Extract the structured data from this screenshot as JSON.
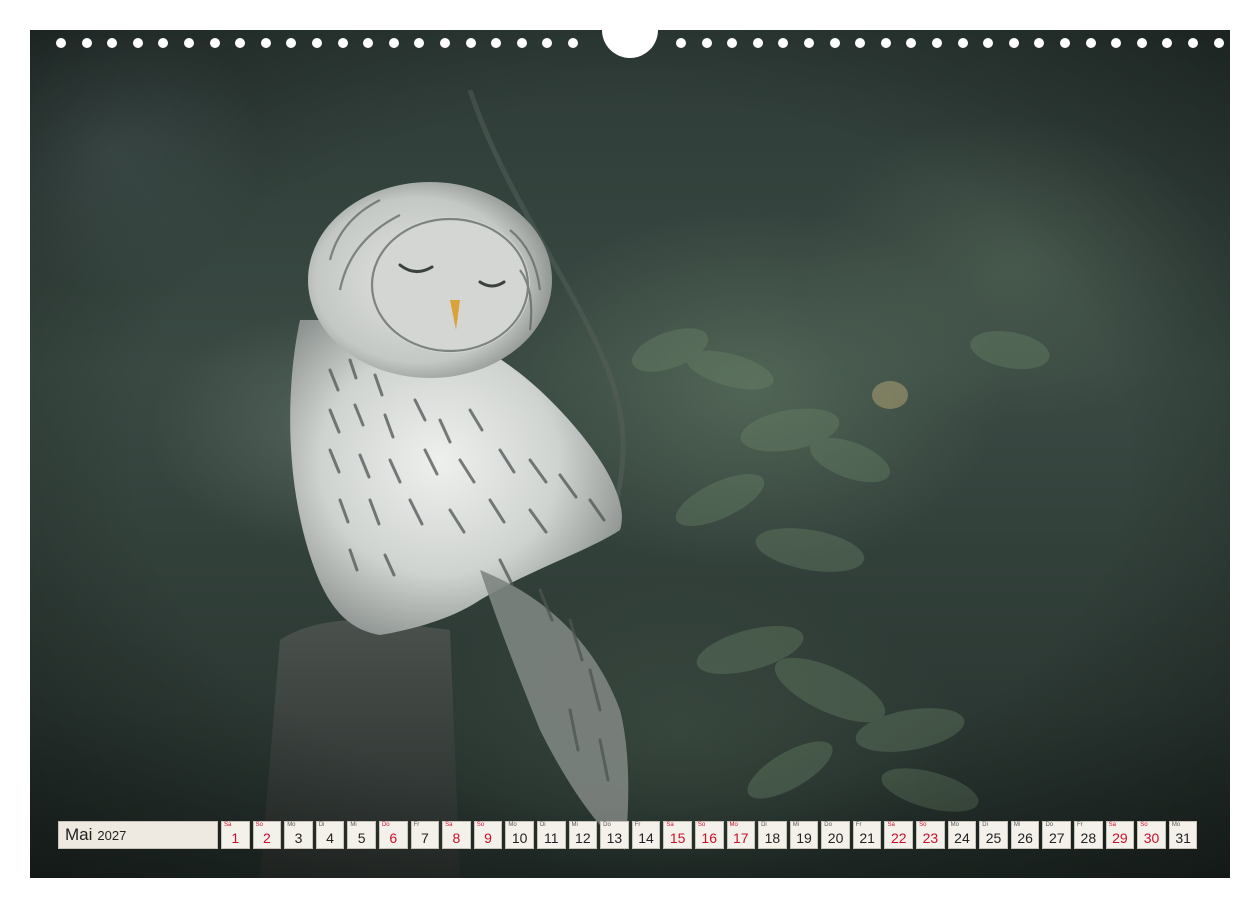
{
  "calendar": {
    "month": "Mai",
    "year": "2027",
    "weekend_color": "#c8102e",
    "days": [
      {
        "wd": "Sa",
        "d": "1",
        "red": true
      },
      {
        "wd": "So",
        "d": "2",
        "red": true
      },
      {
        "wd": "Mo",
        "d": "3",
        "red": false
      },
      {
        "wd": "Di",
        "d": "4",
        "red": false
      },
      {
        "wd": "Mi",
        "d": "5",
        "red": false
      },
      {
        "wd": "Do",
        "d": "6",
        "red": true
      },
      {
        "wd": "Fr",
        "d": "7",
        "red": false
      },
      {
        "wd": "Sa",
        "d": "8",
        "red": true
      },
      {
        "wd": "So",
        "d": "9",
        "red": true
      },
      {
        "wd": "Mo",
        "d": "10",
        "red": false
      },
      {
        "wd": "Di",
        "d": "11",
        "red": false
      },
      {
        "wd": "Mi",
        "d": "12",
        "red": false
      },
      {
        "wd": "Do",
        "d": "13",
        "red": false
      },
      {
        "wd": "Fr",
        "d": "14",
        "red": false
      },
      {
        "wd": "Sa",
        "d": "15",
        "red": true
      },
      {
        "wd": "So",
        "d": "16",
        "red": true
      },
      {
        "wd": "Mo",
        "d": "17",
        "red": true
      },
      {
        "wd": "Di",
        "d": "18",
        "red": false
      },
      {
        "wd": "Mi",
        "d": "19",
        "red": false
      },
      {
        "wd": "Do",
        "d": "20",
        "red": false
      },
      {
        "wd": "Fr",
        "d": "21",
        "red": false
      },
      {
        "wd": "Sa",
        "d": "22",
        "red": true
      },
      {
        "wd": "So",
        "d": "23",
        "red": true
      },
      {
        "wd": "Mo",
        "d": "24",
        "red": false
      },
      {
        "wd": "Di",
        "d": "25",
        "red": false
      },
      {
        "wd": "Mi",
        "d": "26",
        "red": false
      },
      {
        "wd": "Do",
        "d": "27",
        "red": false
      },
      {
        "wd": "Fr",
        "d": "28",
        "red": false
      },
      {
        "wd": "Sa",
        "d": "29",
        "red": true
      },
      {
        "wd": "So",
        "d": "30",
        "red": true
      },
      {
        "wd": "Mo",
        "d": "31",
        "red": false
      }
    ]
  },
  "photo": {
    "subject": "owl-illustration"
  }
}
